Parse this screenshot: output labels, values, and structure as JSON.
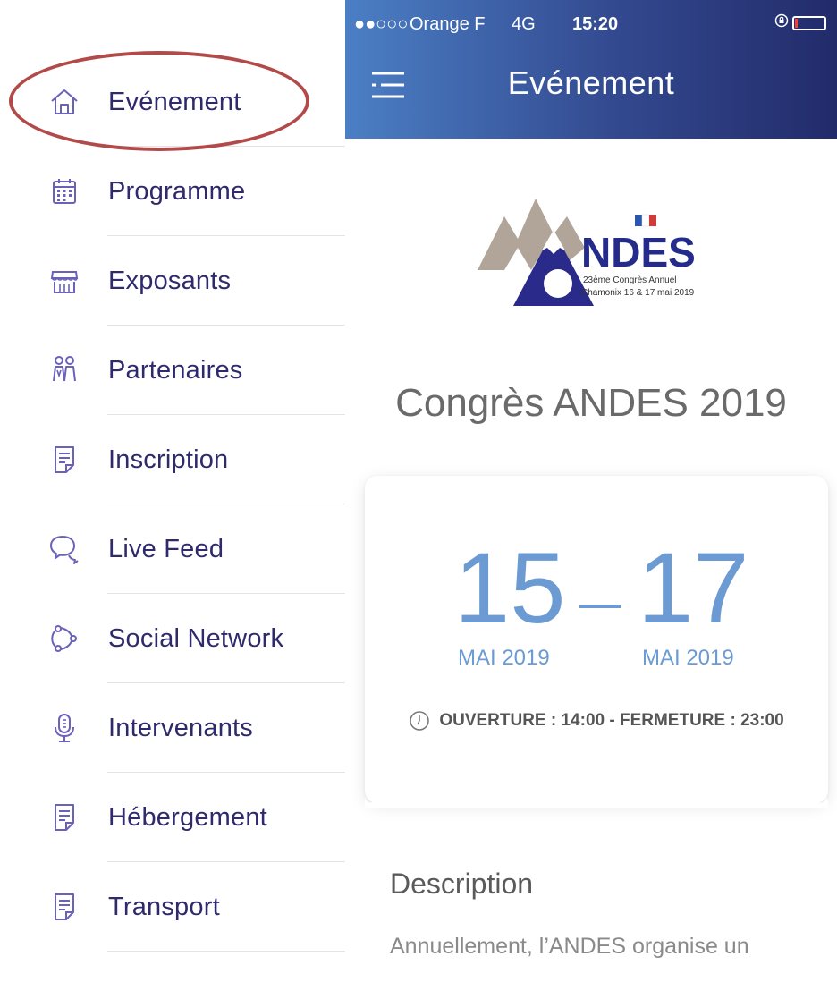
{
  "sidebar": {
    "items": [
      {
        "label": "Evénement",
        "icon": "home-icon"
      },
      {
        "label": "Programme",
        "icon": "calendar-icon"
      },
      {
        "label": "Exposants",
        "icon": "store-icon"
      },
      {
        "label": "Partenaires",
        "icon": "people-icon"
      },
      {
        "label": "Inscription",
        "icon": "document-icon"
      },
      {
        "label": "Live Feed",
        "icon": "chat-bubbles-icon"
      },
      {
        "label": "Social Network",
        "icon": "network-icon"
      },
      {
        "label": "Intervenants",
        "icon": "microphone-icon"
      },
      {
        "label": "Hébergement",
        "icon": "document-icon"
      },
      {
        "label": "Transport",
        "icon": "document-icon"
      }
    ],
    "highlight_color": "#b24a4a",
    "text_color": "#2e2a6b"
  },
  "status_bar": {
    "signal": "●●○○○",
    "carrier": "Orange F",
    "network": "4G",
    "time": "15:20"
  },
  "header": {
    "title": "Evénement",
    "menu_icon": "hamburger-icon",
    "gradient": [
      "#4b7fc5",
      "#33498f",
      "#222b6a"
    ]
  },
  "logo": {
    "brand": "NDES",
    "line1": "23ème Congrès Annuel",
    "line2": "Chamonix 16 & 17 mai 2019"
  },
  "event": {
    "title": "Congrès ANDES 2019",
    "start_day": "15",
    "end_day": "17",
    "start_month": "MAI 2019",
    "end_month": "MAI 2019",
    "hours": "OUVERTURE : 14:00 - FERMETURE : 23:00",
    "accent_color": "#6b9bd2"
  },
  "description": {
    "heading": "Description",
    "text": "Annuellement, l’ANDES organise un"
  }
}
